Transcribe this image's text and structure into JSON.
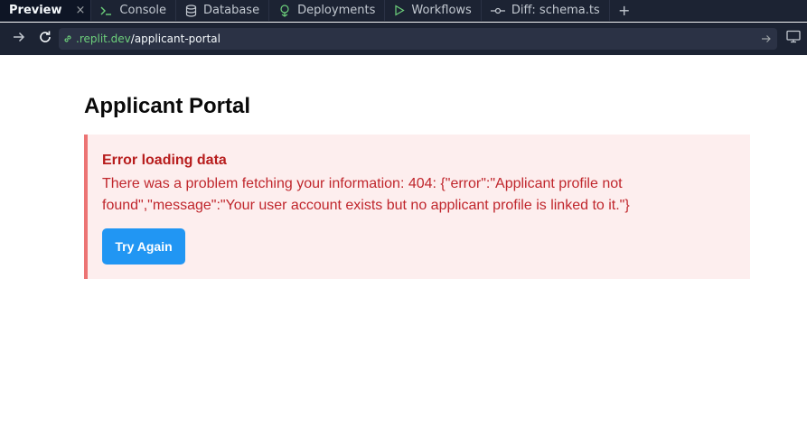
{
  "tabs": [
    {
      "label": "Preview",
      "icon": "none",
      "active": true,
      "closable": true
    },
    {
      "label": "Console",
      "icon": "terminal-icon"
    },
    {
      "label": "Database",
      "icon": "database-icon"
    },
    {
      "label": "Deployments",
      "icon": "deploy-icon"
    },
    {
      "label": "Workflows",
      "icon": "play-icon"
    },
    {
      "label": "Diff: schema.ts",
      "icon": "commit-icon"
    }
  ],
  "tab_close": "×",
  "tab_add": "+",
  "address": {
    "domain": ".replit.dev",
    "path": "/applicant-portal"
  },
  "page": {
    "title": "Applicant Portal",
    "error": {
      "title": "Error loading data",
      "message": "There was a problem fetching your information: 404: {\"error\":\"Applicant profile not found\",\"message\":\"Your user account exists but no applicant profile is linked to it.\"}",
      "button_label": "Try Again"
    }
  },
  "colors": {
    "toolbar_bg": "#1c2333",
    "url_domain": "#6dd07b",
    "error_bg": "#fdeeee",
    "error_border": "#ec7474",
    "error_text": "#c0262c",
    "button_bg": "#2196f3"
  }
}
